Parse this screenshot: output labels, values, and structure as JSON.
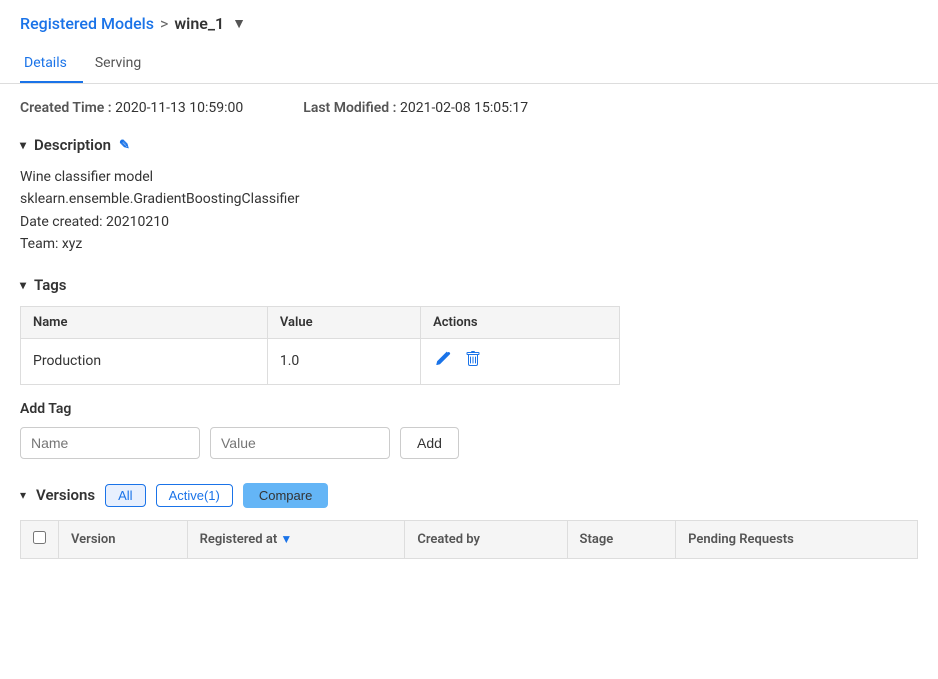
{
  "breadcrumb": {
    "parent_label": "Registered Models",
    "separator": ">",
    "current_model": "wine_1",
    "dropdown_arrow": "▼"
  },
  "tabs": [
    {
      "id": "details",
      "label": "Details",
      "active": true
    },
    {
      "id": "serving",
      "label": "Serving",
      "active": false
    }
  ],
  "meta": {
    "created_label": "Created Time :",
    "created_value": "2020-11-13 10:59:00",
    "modified_label": "Last Modified :",
    "modified_value": "2021-02-08 15:05:17"
  },
  "description": {
    "section_title": "Description",
    "toggle": "▾",
    "edit_icon": "✎",
    "text": "Wine classifier model\nsklearn.ensemble.GradientBoostingClassifier\nDate created: 20210210\nTeam: xyz"
  },
  "tags": {
    "section_title": "Tags",
    "toggle": "▾",
    "table": {
      "headers": [
        "Name",
        "Value",
        "Actions"
      ],
      "rows": [
        {
          "name": "Production",
          "value": "1.0"
        }
      ]
    },
    "add_label": "Add Tag",
    "name_placeholder": "Name",
    "value_placeholder": "Value",
    "add_button": "Add"
  },
  "versions": {
    "section_title": "Versions",
    "toggle": "▾",
    "filters": [
      {
        "label": "All",
        "active": true
      },
      {
        "label": "Active(1)",
        "active": false
      }
    ],
    "compare_button": "Compare",
    "table": {
      "headers": [
        {
          "label": "",
          "sortable": false
        },
        {
          "label": "Version",
          "sortable": false
        },
        {
          "label": "Registered at",
          "sortable": true
        },
        {
          "label": "Created by",
          "sortable": false
        },
        {
          "label": "Stage",
          "sortable": false
        },
        {
          "label": "Pending Requests",
          "sortable": false
        }
      ]
    }
  }
}
